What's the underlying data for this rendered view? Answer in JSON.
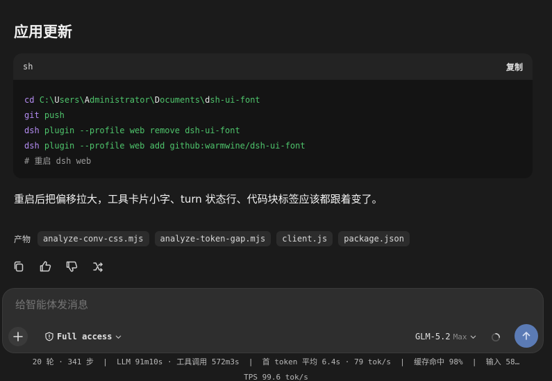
{
  "section_title": "应用更新",
  "code_block": {
    "language": "sh",
    "copy_label": "复制",
    "lines": [
      [
        {
          "t": "cd ",
          "c": "cmd"
        },
        {
          "t": "C:\\",
          "c": "path"
        },
        {
          "t": "U",
          "c": "cap"
        },
        {
          "t": "sers\\",
          "c": "path"
        },
        {
          "t": "A",
          "c": "cap"
        },
        {
          "t": "dministrator\\",
          "c": "path"
        },
        {
          "t": "D",
          "c": "cap"
        },
        {
          "t": "ocuments\\",
          "c": "path"
        },
        {
          "t": "d",
          "c": "cap"
        },
        {
          "t": "sh-ui-font",
          "c": "path"
        }
      ],
      [
        {
          "t": "git ",
          "c": "cmd"
        },
        {
          "t": "push",
          "c": "path"
        }
      ],
      [
        {
          "t": "dsh ",
          "c": "cmd"
        },
        {
          "t": "plugin --profile web remove dsh-ui-font",
          "c": "path"
        }
      ],
      [
        {
          "t": "dsh ",
          "c": "cmd"
        },
        {
          "t": "plugin --profile web add github:warmwine/dsh-ui-font",
          "c": "path"
        }
      ],
      [
        {
          "t": "# 重启 dsh web",
          "c": "comment"
        }
      ]
    ]
  },
  "message_text": "重启后把偏移拉大，工具卡片小字、turn 状态行、代码块标签应该都跟着变了。",
  "artifacts": {
    "label": "产物",
    "files": [
      "analyze-conv-css.mjs",
      "analyze-token-gap.mjs",
      "client.js",
      "package.json"
    ]
  },
  "actions": {
    "copy_icon": "copy-icon",
    "like_icon": "thumbs-up-icon",
    "dislike_icon": "thumbs-down-icon",
    "branch_icon": "branch-icon"
  },
  "composer": {
    "placeholder": "给智能体发消息",
    "access_label": "Full access",
    "model_name": "GLM-5.2",
    "model_tier": "Max"
  },
  "status_bar": {
    "line1": "20 轮 · 341 步  |  LLM 91m10s · 工具调用 572m3s  |  首 token 平均 6.4s · 79 tok/s  |  缓存命中 98%  |  输入 58…",
    "line2": "TPS 99.6 tok/s"
  },
  "colors": {
    "background": "#1b1b1b",
    "code_command": "#b48cf2",
    "code_text": "#4ec36b",
    "send_button": "#5b7bb5"
  }
}
